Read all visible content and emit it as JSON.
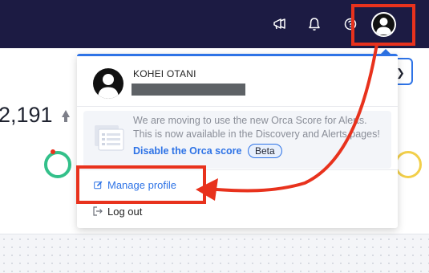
{
  "topbar": {
    "icons": [
      "megaphone-icon",
      "bell-icon",
      "help-icon",
      "user-avatar-icon"
    ]
  },
  "background": {
    "metric_value": "2,191"
  },
  "profile_menu": {
    "user_name": "KOHEI OTANI",
    "notice": {
      "text": "We are moving to use the new Orca Score for Alerts. This is now available in the Discovery and Alerts pages!",
      "link_label": "Disable the Orca score",
      "badge": "Beta"
    },
    "items": [
      {
        "label": "Manage profile",
        "icon": "edit-icon"
      },
      {
        "label": "Log out",
        "icon": "logout-icon"
      }
    ]
  },
  "annotation": {
    "highlight_color": "#e8321d"
  },
  "colors": {
    "topbar_bg": "#1c1b43",
    "accent": "#2e73e6",
    "annotation": "#e8321d"
  }
}
